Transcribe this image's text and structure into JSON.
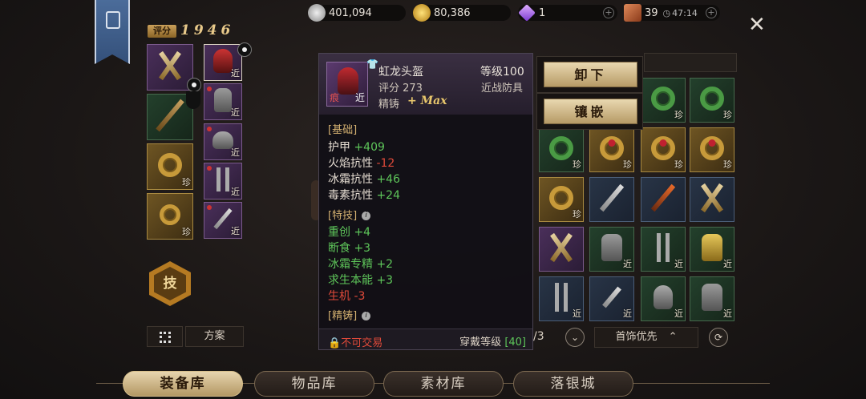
{
  "resources": {
    "silver": "401,094",
    "gold": "80,386",
    "diamond": "1",
    "stamina": "39",
    "timer": "47:14"
  },
  "score": {
    "label": "评分",
    "value": "1946"
  },
  "tooltip": {
    "name": "虹龙头盔",
    "level": "等级100",
    "score": "评分 273",
    "category": "近战防具",
    "forge_label": "精铸",
    "forge_value": "+ Max",
    "icon_mark": "痕",
    "icon_tag": "近",
    "section_basic": "[基础]",
    "stats": [
      {
        "name": "护甲",
        "value": "+409",
        "neg": false
      },
      {
        "name": "火焰抗性",
        "value": "-12",
        "neg": true
      },
      {
        "name": "冰霜抗性",
        "value": "+46",
        "neg": false
      },
      {
        "name": "毒素抗性",
        "value": "+24",
        "neg": false
      }
    ],
    "section_skill": "[特技]",
    "skills": [
      {
        "text": "重创 +4",
        "bad": false
      },
      {
        "text": "断食 +3",
        "bad": false
      },
      {
        "text": "冰霜专精 +2",
        "bad": false
      },
      {
        "text": "求生本能 +3",
        "bad": false
      },
      {
        "text": "生机 -3",
        "bad": true
      }
    ],
    "section_forge": "[精铸]",
    "trade": "不可交易",
    "wear_label": "穿戴等级",
    "wear_level": "[40]"
  },
  "actions": {
    "unequip": "卸下",
    "inlay": "镶嵌"
  },
  "skill_button": "技",
  "plan_button": "方案",
  "page_indicator": "/3",
  "sort_option": "首饰优先",
  "tabs": [
    "装备库",
    "物品库",
    "素材库",
    "落银城"
  ],
  "slot_tags": {
    "rare": "珍",
    "melee": "近"
  }
}
